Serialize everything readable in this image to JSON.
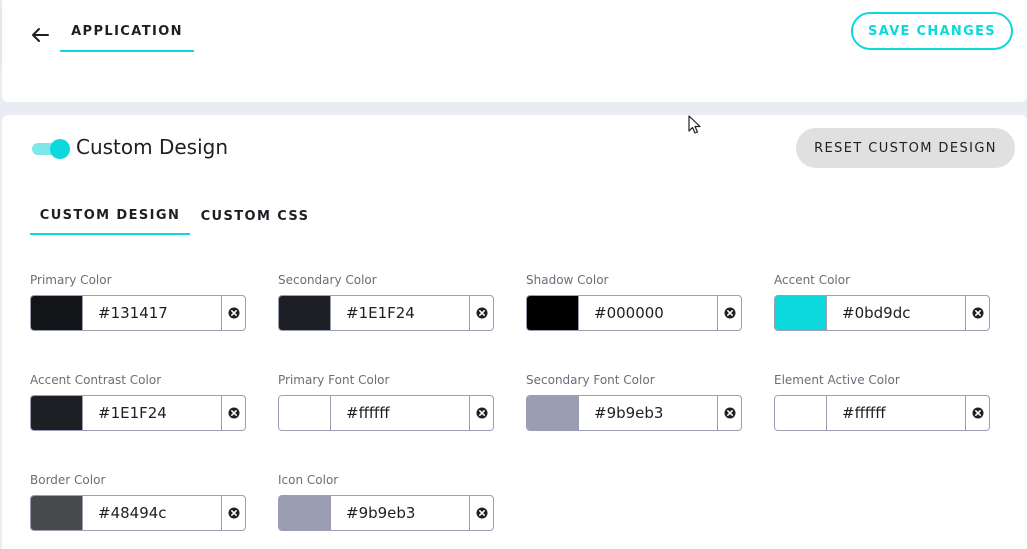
{
  "header": {
    "tab_label": "APPLICATION",
    "save_label": "SAVE CHANGES"
  },
  "panel": {
    "title": "Custom Design",
    "toggle_on": true,
    "reset_label": "RESET CUSTOM DESIGN",
    "tabs": [
      {
        "label": "CUSTOM DESIGN",
        "active": true
      },
      {
        "label": "CUSTOM CSS",
        "active": false
      }
    ],
    "colors": [
      {
        "label": "Primary Color",
        "value": "#131417",
        "swatch": "#131417"
      },
      {
        "label": "Secondary Color",
        "value": "#1E1F24",
        "swatch": "#1E1F24"
      },
      {
        "label": "Shadow Color",
        "value": "#000000",
        "swatch": "#000000"
      },
      {
        "label": "Accent Color",
        "value": "#0bd9dc",
        "swatch": "#0bd9dc"
      },
      {
        "label": "Accent Contrast Color",
        "value": "#1E1F24",
        "swatch": "#1E1F24"
      },
      {
        "label": "Primary Font Color",
        "value": "#ffffff",
        "swatch": "#ffffff"
      },
      {
        "label": "Secondary Font Color",
        "value": "#9b9eb3",
        "swatch": "#9b9eb3"
      },
      {
        "label": "Element Active Color",
        "value": "#ffffff",
        "swatch": "#ffffff"
      },
      {
        "label": "Border Color",
        "value": "#48494c",
        "swatch": "#48494c"
      },
      {
        "label": "Icon Color",
        "value": "#9b9eb3",
        "swatch": "#9b9eb3"
      }
    ]
  },
  "theme": {
    "accent": "#0bd9dc",
    "text": "#1e1f24",
    "muted": "#6b6e78"
  }
}
